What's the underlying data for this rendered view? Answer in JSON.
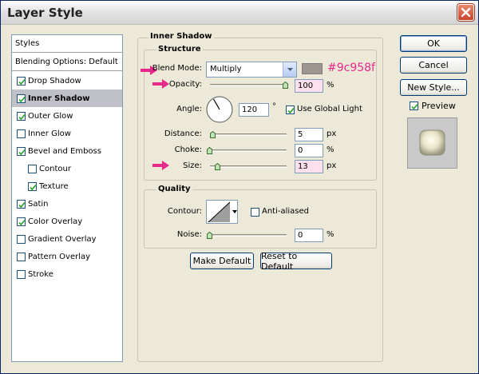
{
  "window": {
    "title": "Layer Style"
  },
  "styles_list": {
    "header": "Styles",
    "blending_options": "Blending Options: Default",
    "items": [
      {
        "label": "Drop Shadow",
        "checked": true,
        "indent": false,
        "selected": false
      },
      {
        "label": "Inner Shadow",
        "checked": true,
        "indent": false,
        "selected": true
      },
      {
        "label": "Outer Glow",
        "checked": true,
        "indent": false,
        "selected": false
      },
      {
        "label": "Inner Glow",
        "checked": false,
        "indent": false,
        "selected": false
      },
      {
        "label": "Bevel and Emboss",
        "checked": true,
        "indent": false,
        "selected": false
      },
      {
        "label": "Contour",
        "checked": false,
        "indent": true,
        "selected": false
      },
      {
        "label": "Texture",
        "checked": true,
        "indent": true,
        "selected": false
      },
      {
        "label": "Satin",
        "checked": true,
        "indent": false,
        "selected": false
      },
      {
        "label": "Color Overlay",
        "checked": true,
        "indent": false,
        "selected": false
      },
      {
        "label": "Gradient Overlay",
        "checked": false,
        "indent": false,
        "selected": false
      },
      {
        "label": "Pattern Overlay",
        "checked": false,
        "indent": false,
        "selected": false
      },
      {
        "label": "Stroke",
        "checked": false,
        "indent": false,
        "selected": false
      }
    ]
  },
  "inner_shadow": {
    "section_title": "Inner Shadow",
    "structure_title": "Structure",
    "blend_mode_label": "Blend Mode:",
    "blend_mode_value": "Multiply",
    "color_hex": "#9c958f",
    "color_annotation": "#9c958f",
    "opacity_label": "Opacity:",
    "opacity_value": "100",
    "opacity_level": 1.0,
    "percent": "%",
    "angle_label": "Angle:",
    "angle_value": "120",
    "degree": "°",
    "use_global_light_label": "Use Global Light",
    "use_global_light": true,
    "distance_label": "Distance:",
    "distance_value": "5",
    "distance_level": 0.0,
    "px": "px",
    "choke_label": "Choke:",
    "choke_value": "0",
    "choke_level": 0.0,
    "size_label": "Size:",
    "size_value": "13",
    "size_level": 0.07
  },
  "quality": {
    "title": "Quality",
    "contour_label": "Contour:",
    "anti_aliased_label": "Anti-aliased",
    "anti_aliased": false,
    "noise_label": "Noise:",
    "noise_value": "0",
    "noise_level": 0.0,
    "percent": "%"
  },
  "buttons": {
    "make_default": "Make Default",
    "reset_to_default": "Reset to Default",
    "ok": "OK",
    "cancel": "Cancel",
    "new_style": "New Style...",
    "preview_label": "Preview",
    "preview_checked": true
  },
  "colors": {
    "annotation_arrow": "#e8288a",
    "selected_row": "#c0c0c8"
  }
}
